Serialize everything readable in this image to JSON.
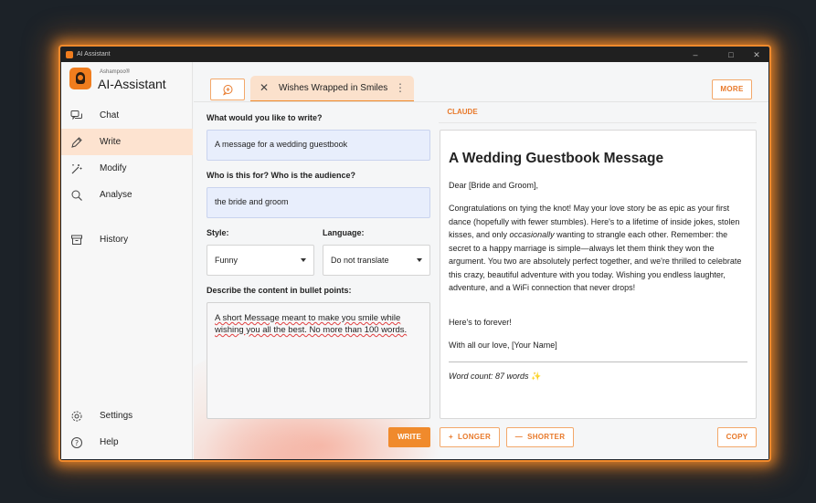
{
  "window": {
    "title": "AI Assistant"
  },
  "brand": {
    "small": "Ashampoo®",
    "name": "AI-Assistant",
    "accent": "#f08a2c"
  },
  "sidebar": {
    "items": [
      {
        "label": "Chat",
        "icon": "chat-bubbles-icon"
      },
      {
        "label": "Write",
        "icon": "pen-icon",
        "active": true
      },
      {
        "label": "Modify",
        "icon": "magic-wand-icon"
      },
      {
        "label": "Analyse",
        "icon": "search-icon"
      },
      {
        "label": "History",
        "icon": "archive-box-icon"
      }
    ],
    "bottom": [
      {
        "label": "Settings",
        "icon": "gear-icon"
      },
      {
        "label": "Help",
        "icon": "help-icon"
      }
    ]
  },
  "tabs": {
    "active_label": "Wishes Wrapped in Smiles",
    "more_label": "MORE"
  },
  "form": {
    "what_label": "What would you like to write?",
    "what_value": "A message for a wedding guestbook",
    "audience_label": "Who is this for? Who is the audience?",
    "audience_value": "the bride and groom",
    "style_label": "Style:",
    "style_value": "Funny",
    "language_label": "Language:",
    "language_value": "Do not translate",
    "bullets_label": "Describe the content in bullet points:",
    "bullets_text": "A short Message meant to make you smile while wishing you all the best. No more than 100 words."
  },
  "output": {
    "provider": "CLAUDE",
    "heading": "A Wedding Guestbook Message",
    "greeting": "Dear [Bride and Groom],",
    "body_1": "Congratulations on tying the knot! May your love story be as epic as your first dance (hopefully with fewer stumbles). Here's to a lifetime of inside jokes, stolen kisses, and only ",
    "body_em": "occasionally",
    "body_2": " wanting to strangle each other. Remember: the secret to a happy marriage is simple—always let them think they won the argument. You two are absolutely perfect together, and we're thrilled to celebrate this crazy, beautiful adventure with you today. Wishing you endless laughter, adventure, and a WiFi connection that never drops!",
    "closing_1": "Here's to forever!",
    "closing_2": "With all our love, [Your Name]",
    "word_count": "Word count: 87 words"
  },
  "buttons": {
    "write": "WRITE",
    "longer": "LONGER",
    "shorter": "SHORTER",
    "copy": "COPY"
  }
}
